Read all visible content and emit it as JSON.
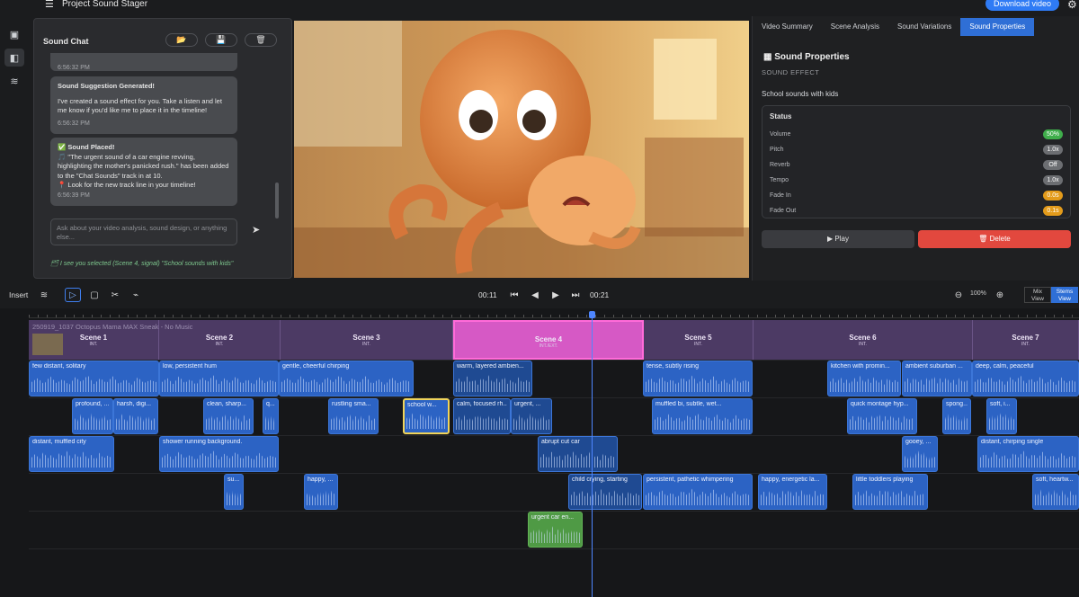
{
  "app": {
    "title": "Project Sound Stager",
    "download_label": "Download video"
  },
  "chat": {
    "title": "Sound Chat",
    "tools": [
      "📂",
      "💾",
      "🗑"
    ],
    "partial_top_ts": "6:56:32 PM",
    "messages": [
      {
        "title": "Sound Suggestion Generated!",
        "body": "I've created a sound effect for you. Take a listen and let me know if you'd like me to place it in the timeline!",
        "ts": "6:56:32 PM"
      },
      {
        "title": "✅ Sound Placed!",
        "body": "🎵 \"The urgent sound of a car engine revving, highlighting the mother's panicked rush.\" has been added to the \"Chat Sounds\" track in at 10.",
        "note": "📍 Look for the new track line in your timeline!",
        "ts": "6:56:39 PM"
      }
    ],
    "input_placeholder": "Ask about your video analysis, sound design, or anything else...",
    "status": "🗂 I see you selected (Scene 4, signal) \"School sounds with kids\""
  },
  "right_panel": {
    "tabs": [
      "Video Summary",
      "Scene Analysis",
      "Sound Variations",
      "Sound Properties"
    ],
    "active_tab": "Sound Properties",
    "title": "Sound Properties",
    "subtitle": "SOUND EFFECT",
    "sound_name": "School sounds with kids",
    "status_label": "Status",
    "stats": [
      {
        "label": "Volume",
        "value": "50%",
        "color": "#3fae4b"
      },
      {
        "label": "Pitch",
        "value": "1.0x",
        "color": "#6c6e72"
      },
      {
        "label": "Reverb",
        "value": "Off",
        "color": "#6c6e72"
      },
      {
        "label": "Tempo",
        "value": "1.0x",
        "color": "#6c6e72"
      },
      {
        "label": "Fade In",
        "value": "0.0s",
        "color": "#e39b1b"
      },
      {
        "label": "Fade Out",
        "value": "0.1s",
        "color": "#e39b1b"
      }
    ],
    "play_label": "▶ Play",
    "delete_label": "🗑 Delete"
  },
  "toolbar": {
    "insert_label": "Insert",
    "time_current": "00:11",
    "time_total": "00:21",
    "zoom": "100%",
    "view_mix": "Mix\nView",
    "view_stems": "Stems\nView"
  },
  "timeline": {
    "video_name": "250919_1037 Octopus Mama MAX Sneak - No Music",
    "scenes": [
      {
        "name": "Scene 1",
        "info": "INT."
      },
      {
        "name": "Scene 2",
        "info": "INT."
      },
      {
        "name": "Scene 3",
        "info": "INT."
      },
      {
        "name": "Scene 4",
        "info": "INT./EXT."
      },
      {
        "name": "Scene 5",
        "info": "INT."
      },
      {
        "name": "Scene 6",
        "info": "INT."
      },
      {
        "name": "Scene 7",
        "info": "INT."
      }
    ],
    "clips": {
      "row1": [
        "few distant, solitary",
        "low, persistent hum",
        "gentle, cheerful chirping",
        "warm, layered ambien...",
        "tense, subtly rising",
        "kitchen with promin...",
        "ambient suburban ...",
        "deep, calm, peaceful"
      ],
      "row2": [
        "profound, ...",
        "harsh, digi...",
        "clean, sharp...",
        "q...",
        "rustling sma...",
        "school w...",
        "calm, focused rh...",
        "urgent, ...",
        "muffled bi, subtle, wet...",
        "quick montage hyp...",
        "spong...",
        "soft, i..."
      ],
      "row3": [
        "distant, muffled city",
        "shower running background.",
        "abrupt cut car",
        "gooey, ...",
        "distant, chirping single"
      ],
      "row4": [
        "su...",
        "happy, ...",
        "child crying, starting",
        "persistent, pathetic whimpering",
        "happy, energetic la...",
        "little toddlers playing",
        "soft, heartw..."
      ],
      "row5": [
        "urgent car en..."
      ]
    }
  }
}
